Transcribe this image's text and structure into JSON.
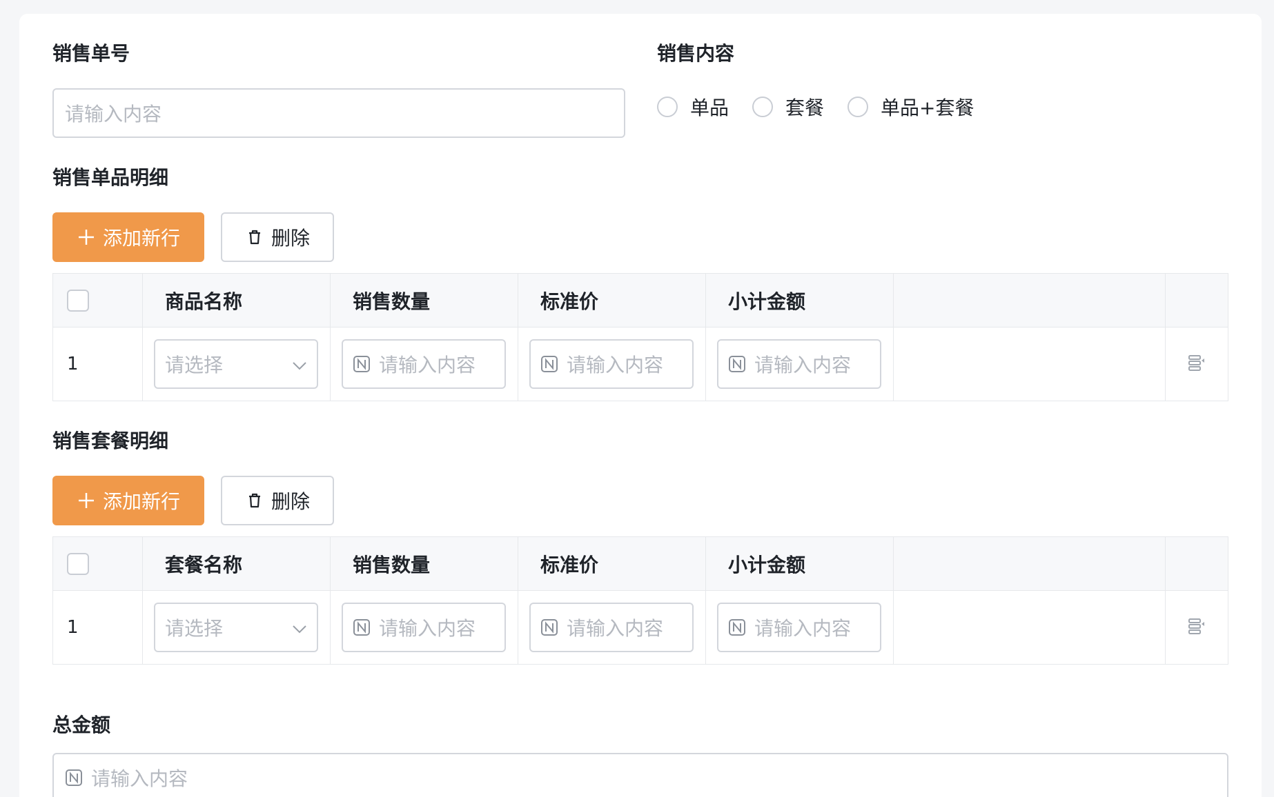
{
  "form": {
    "order_no": {
      "label": "销售单号",
      "placeholder": "请输入内容"
    },
    "content": {
      "label": "销售内容",
      "options": [
        "单品",
        "套餐",
        "单品+套餐"
      ]
    },
    "single_section": {
      "title": "销售单品明细",
      "add_label": "添加新行",
      "delete_label": "删除",
      "headers": [
        "商品名称",
        "销售数量",
        "标准价",
        "小计金额"
      ],
      "rows": [
        {
          "index": "1",
          "select_placeholder": "请选择",
          "input_placeholder": "请输入内容"
        }
      ]
    },
    "package_section": {
      "title": "销售套餐明细",
      "add_label": "添加新行",
      "delete_label": "删除",
      "headers": [
        "套餐名称",
        "销售数量",
        "标准价",
        "小计金额"
      ],
      "rows": [
        {
          "index": "1",
          "select_placeholder": "请选择",
          "input_placeholder": "请输入内容"
        }
      ]
    },
    "total": {
      "label": "总金额",
      "placeholder": "请输入内容"
    }
  },
  "icons": {
    "add": "plus-icon",
    "delete": "trash-icon",
    "number": "number-n-icon",
    "dropdown": "chevron-down-icon",
    "row_action": "row-action-icon"
  },
  "colors": {
    "primary": "#f0994a",
    "border": "#d3d6dc",
    "placeholder": "#b5b9c0",
    "header_bg": "#f7f8fa"
  }
}
